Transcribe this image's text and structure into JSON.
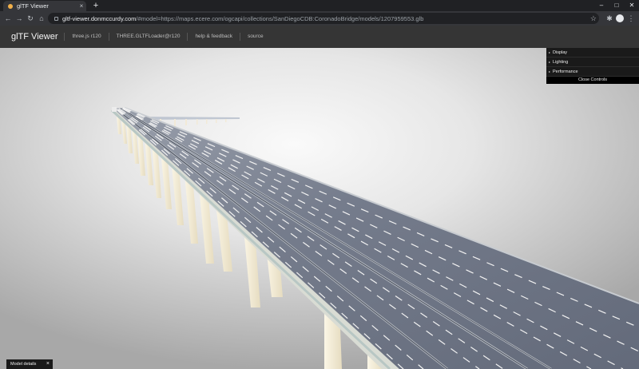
{
  "browser": {
    "tab": {
      "title": "glTF Viewer",
      "close": "×"
    },
    "new_tab": "+",
    "window_controls": {
      "minimize": "–",
      "maximize": "□",
      "close": "✕"
    },
    "nav": {
      "back": "←",
      "forward": "→",
      "reload": "↻",
      "home": "⌂"
    },
    "url": {
      "host": "gltf-viewer.donmccurdy.com",
      "rest": "/#model=https://maps.ecere.com/ogcapi/collections/SanDiegoCDB:CoronadoBridge/models/1207959553.glb"
    },
    "star": "☆",
    "extensions": "✱",
    "menu": "⋮"
  },
  "header": {
    "title": "glTF Viewer",
    "links": [
      "three.js r120",
      "THREE.GLTFLoader@r120",
      "help & feedback",
      "source"
    ]
  },
  "controls": {
    "folders": [
      "Display",
      "Lighting",
      "Performance"
    ],
    "close_label": "Close Controls",
    "arrow": "▸"
  },
  "model_details": {
    "label": "Model details",
    "close": "×"
  },
  "colors": {
    "deck": "#6f7686",
    "railing": "#d8d8d2",
    "pillar": "#f2ecd8",
    "background_center": "#fafafa"
  }
}
